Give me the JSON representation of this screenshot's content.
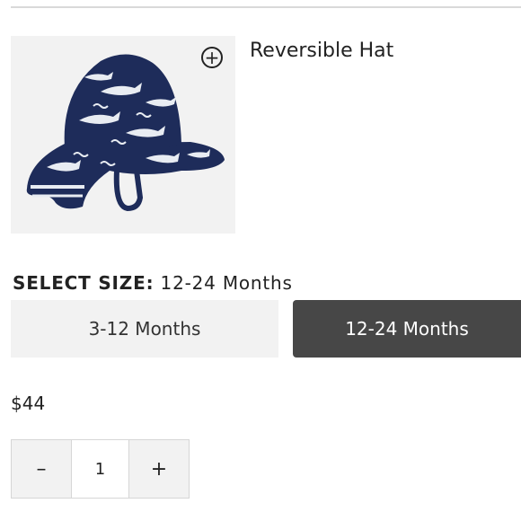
{
  "product": {
    "title": "Reversible Hat",
    "image_alt": "Navy shark print sun hat",
    "zoom_icon": "plus-circle-icon"
  },
  "size": {
    "label": "SELECT SIZE:",
    "selected": "12-24 Months",
    "options": [
      "3-12 Months",
      "12-24 Months"
    ]
  },
  "price": "$44",
  "quantity": {
    "decrement": "–",
    "value": "1",
    "increment": "+"
  },
  "colors": {
    "selected_bg": "#474747",
    "unselected_bg": "#f2f2f2",
    "hat_navy": "#1e2c5a"
  }
}
